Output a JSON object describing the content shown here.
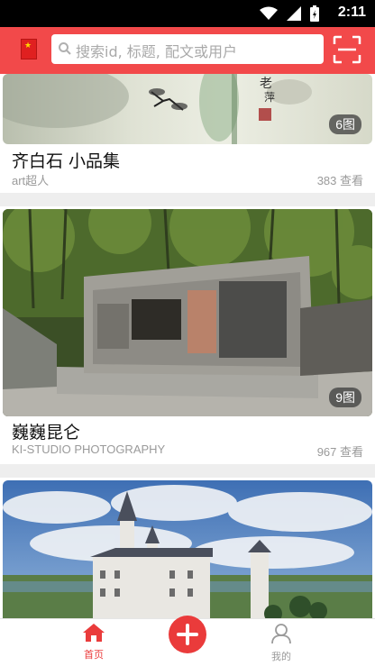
{
  "status_bar": {
    "time": "2:11",
    "icons": [
      "wifi-icon",
      "signal-icon",
      "battery-charging-icon"
    ]
  },
  "header": {
    "flag_icon": "china-flag-icon",
    "search_placeholder": "搜索id, 标题, 配文或用户",
    "scan_icon": "scan-icon",
    "accent_color": "#f2494a"
  },
  "feed": [
    {
      "title": "齐白石 小品集",
      "author": "art超人",
      "views": "383 查看",
      "image_count": "6图"
    },
    {
      "title": "巍巍昆仑",
      "author": "KI-STUDIO PHOTOGRAPHY",
      "views": "967 查看",
      "image_count": "9图"
    },
    {
      "title": "",
      "author": "",
      "views": "",
      "image_count": ""
    }
  ],
  "bottom_nav": {
    "home_label": "首页",
    "home_icon": "home-icon",
    "add_icon": "plus-icon",
    "profile_label": "我的",
    "profile_icon": "user-icon",
    "active_color": "#ea3b3b"
  }
}
